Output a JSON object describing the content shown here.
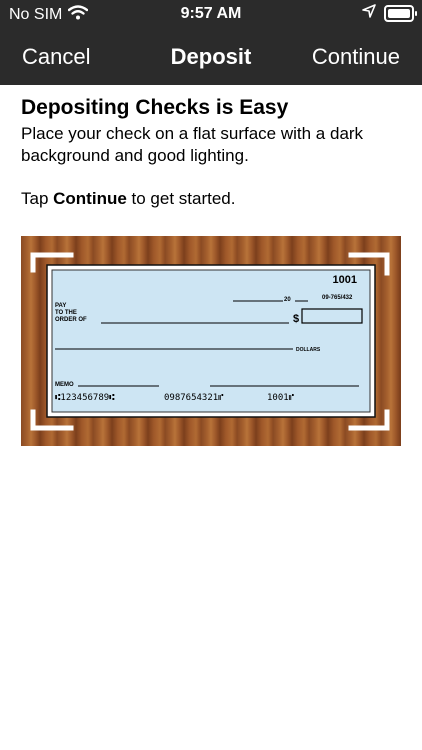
{
  "status": {
    "carrier": "No SIM",
    "time": "9:57 AM"
  },
  "nav": {
    "cancel": "Cancel",
    "title": "Deposit",
    "continue": "Continue"
  },
  "content": {
    "heading": "Depositing Checks is Easy",
    "instructions": "Place your check on a flat surface with a dark background and good lighting.",
    "tap_prefix": "Tap ",
    "tap_bold": "Continue",
    "tap_suffix": " to get started."
  },
  "check": {
    "number": "1001",
    "date_suffix": "20",
    "routing_fraction": "09-765/432",
    "pay_line1": "PAY",
    "pay_line2": "TO THE",
    "pay_line3": "ORDER OF",
    "dollar_sign": "$",
    "dollars_label": "DOLLARS",
    "memo_label": "MEMO",
    "micr_routing": "⑆123456789⑆",
    "micr_account": "0987654321⑈",
    "micr_number": "1001⑈"
  },
  "icons": [
    "wifi-icon",
    "location-arrow-icon",
    "battery-icon"
  ],
  "colors": {
    "nav_bg": "#2b2b2b",
    "check_bg": "#cde5f3",
    "wood": "#a5602e"
  }
}
